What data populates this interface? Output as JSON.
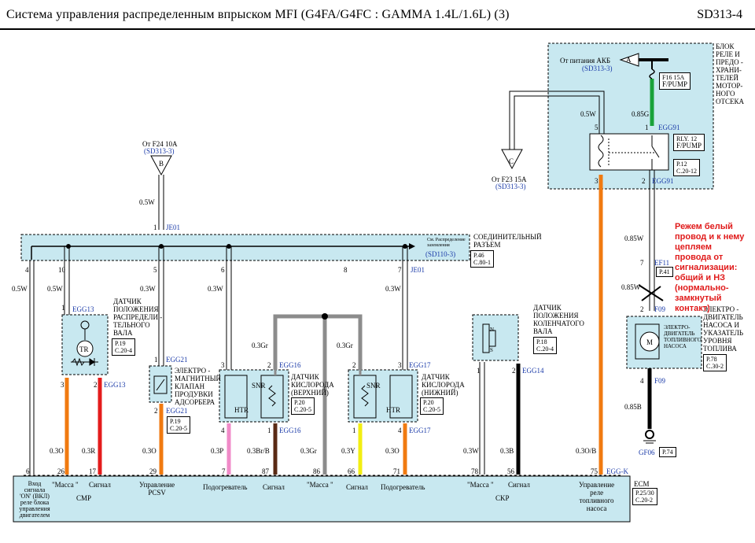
{
  "header": {
    "title": "Система  управления  распределенным    впрыском  MFI (G4FA/G4FC : GAMMA 1.4L/1.6L) (3)",
    "code": "SD313-4"
  },
  "relay_block": {
    "name": "БЛОК\nРЕЛЕ  И\nПРЕДО -\nХРАНИ-\nТЕЛЕЙ\nМОТОР-\nНОГО\nОТСЕКА",
    "battery": "От питания  АКБ",
    "battery_ref": "(SD313-3)",
    "term_a": "A",
    "fuse": "F16 15A",
    "fuse_name": "F/PUMP",
    "relay": "RLY. 12",
    "relay_name": "F/PUMP",
    "relay_ref": "P.12\nC.20-12",
    "wire_5w": "0.5W",
    "wire_085g": "0.85G",
    "egg91_top": "EGG91",
    "egg91_bot": "EGG91",
    "pin5": "5",
    "pin1": "1",
    "pin3": "3",
    "pin2": "2"
  },
  "source_b": {
    "from": "От F24 10A",
    "ref": "(SD313-3)",
    "term": "B",
    "wire": "0.5W",
    "pin": "1",
    "conn": "JE01"
  },
  "source_c": {
    "from": "От F23 15A",
    "ref": "(SD313-3)",
    "term": "C"
  },
  "joint": {
    "name": "СОЕДИНИТЕЛЬНЫЙ\nРАЗЪЕМ",
    "see": "См. Распределение\nзаземления",
    "see_ref": "(SD110-3)",
    "ref": "P.46\nC.80-1",
    "pins": [
      "4",
      "10",
      "5",
      "6",
      "8",
      "7"
    ],
    "conn2": "JE01"
  },
  "wires": {
    "w05w_left": "0.5W",
    "w05w_cmp": "0.5W",
    "w03w_pcsv": "0.3W",
    "w03w_o2u": "0.3W",
    "w03w_o2l": "0.3W",
    "w03gr_a": "0.3Gr",
    "w03gr_b": "0.3Gr",
    "w03w_ckp": "0.3W",
    "w085w_a": "0.85W",
    "w085w_b": "0.85W",
    "w085b": "0.85B",
    "w03o_cmp": "0.3O",
    "w03r": "0.3R",
    "w03o_pcsv": "0.3O",
    "w03p": "0.3P",
    "w03brb": "0.3Br/B",
    "w03gr_ecm": "0.3Gr",
    "w03y": "0.3Y",
    "w03o_o2l": "0.3O",
    "w03w_ecm": "0.3W",
    "w03b": "0.3B",
    "w03ob": "0.3O/B"
  },
  "cmp": {
    "name": "ДАТЧИК\nПОЛОЖЕНИЯ\nРАСПРЕДЕЛИ -\nТЕЛЬНОГО\nВАЛА",
    "conn": "EGG13",
    "conn2": "EGG13",
    "ref": "P.19\nC.20-4",
    "tr": "TR",
    "p3": "3",
    "p2": "2",
    "p1": "1"
  },
  "pcsv": {
    "name": "ЭЛЕКТРО -\nМАГНИТНЫЙ\nКЛАПАН\nПРОДУВКИ\nАДСОРБЕРА",
    "conn": "EGG21",
    "conn2": "EGG21",
    "ref": "P.19\nC.20-5",
    "p1": "1",
    "p2": "2"
  },
  "o2u": {
    "name": "ДАТЧИК\nКИСЛОРОДА\n(ВЕРХНИЙ)",
    "conn": "EGG16",
    "conn2": "EGG16",
    "ref": "P.20\nC.20-5",
    "snr": "SNR",
    "htr": "HTR",
    "p3": "3",
    "p2": "2",
    "p4": "4",
    "p1": "1"
  },
  "o2l": {
    "name": "ДАТЧИК\nКИСЛОРОДА\n(НИЖНИЙ)",
    "conn": "EGG17",
    "conn2": "EGG17",
    "ref": "P.20\nC.20-5",
    "snr": "SNR",
    "htr": "HTR",
    "p2": "2",
    "p3": "3",
    "p1": "1",
    "p4": "4"
  },
  "ckp": {
    "name": "ДАТЧИК\nПОЛОЖЕНИЯ\nКОЛЕНЧАТОГО\nВАЛА",
    "conn": "EGG14",
    "ref": "P.18\nC.20-4",
    "n": "N",
    "s": "S",
    "p1": "1",
    "p2": "2"
  },
  "pump": {
    "name": "ЭЛЕКТРО -\nДВИГАТЕЛЬ\nНАСОСА И\nУКАЗАТЕЛЬ\nУРОВНЯ\nТОПЛИВА",
    "inner": "ЭЛЕКТРО-\nДВИГАТЕЛЬ\nТОПЛИВНОГО\nНАСОСА",
    "m": "M",
    "ref": "P.78\nC.30-2",
    "ef11": "EF11",
    "ef11_ref": "P.41",
    "f09_top": "F09",
    "f09_bot": "F09",
    "p7": "7",
    "p2": "2",
    "p4": "4",
    "ground": "GF06",
    "ground_ref": "P.74"
  },
  "note": "Режем белый\nпровод и к нему\nцепляем\nпровода от\nсигнализации:\nобщий и НЗ\n(нормально-\nзамкнутый\nконтакт)",
  "ecm": {
    "name": "ECM",
    "ref": "P.25/30\nC.20-2",
    "conn": "EGG-K",
    "pins": [
      "6",
      "26",
      "17",
      "29",
      "7",
      "87",
      "86",
      "66",
      "71",
      "78",
      "56",
      "75"
    ],
    "l_input": "Вход\nсигнала\n'ON' (ВКЛ)\nреле  блока\nуправления\nдвигателем",
    "l_mass_cmp": "\"Масса \"",
    "l_sig_cmp": "Сигнал",
    "l_cmp": "CMP",
    "l_pcsv": "Управление\nPCSV",
    "l_heat1": "Подогреватель",
    "l_sig1": "Сигнал",
    "l_mass": "\"Масса \"",
    "l_sig2": "Сигнал",
    "l_heat2": "Подогреватель",
    "l_mass_ckp": "\"Масса \"",
    "l_sig_ckp": "Сигнал",
    "l_ckp": "CKP",
    "l_pump": "Управление\nреле\nтопливного\nнасоса"
  },
  "colors": {
    "panel": "#c8e8f0",
    "orange": "#f07a10",
    "red": "#e41c1c",
    "pink": "#f08ac8",
    "brown": "#5a2a14",
    "gray": "#8c8c8c",
    "yellow": "#f2ee12",
    "green": "#19a23a",
    "white_wire": "#ffffff"
  }
}
